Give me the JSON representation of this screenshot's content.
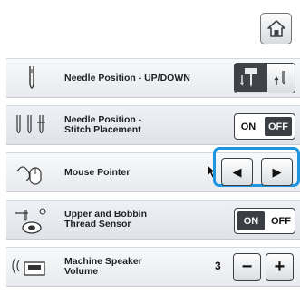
{
  "header": {
    "home_icon": "home-icon"
  },
  "rows": [
    {
      "label": "Needle Position - UP/DOWN",
      "icon": "needle-icon",
      "control": "needle-up-down-toggle"
    },
    {
      "label": "Needle Position -\nStitch Placement",
      "icon": "triple-needle-icon",
      "on_label": "ON",
      "off_label": "OFF",
      "selected": "OFF"
    },
    {
      "label": "Mouse Pointer",
      "icon": "mouse-pointer-icon",
      "left_arrow": "◀",
      "right_arrow": "▶",
      "pointer_icon": "arrow-cursor-icon"
    },
    {
      "label": "Upper and Bobbin\nThread Sensor",
      "icon": "thread-sensor-icon",
      "on_label": "ON",
      "off_label": "OFF",
      "selected": "ON"
    },
    {
      "label": "Machine Speaker\nVolume",
      "icon": "speaker-icon",
      "value": "3",
      "minus": "−",
      "plus": "+"
    }
  ],
  "colors": {
    "focus": "#1f95e0",
    "active_segment": "#3b3e43"
  }
}
